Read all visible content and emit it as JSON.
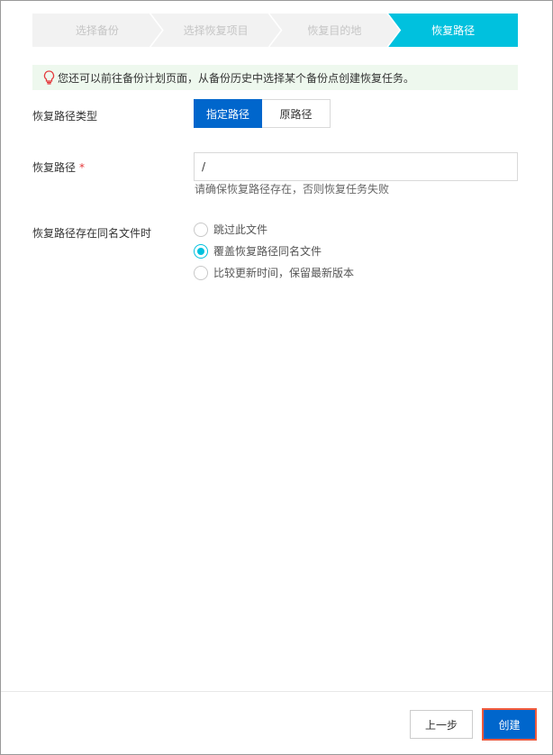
{
  "steps": [
    {
      "label": "选择备份"
    },
    {
      "label": "选择恢复项目"
    },
    {
      "label": "恢复目的地"
    },
    {
      "label": "恢复路径"
    }
  ],
  "tip": {
    "text": "您还可以前往备份计划页面，从备份历史中选择某个备份点创建恢复任务。",
    "icon": "lightbulb-icon"
  },
  "form": {
    "path_type_label": "恢复路径类型",
    "path_type_options": [
      "指定路径",
      "原路径"
    ],
    "path_label": "恢复路径",
    "required_mark": "*",
    "path_value": "/",
    "path_hint": "请确保恢复路径存在，否则恢复任务失败",
    "conflict_label": "恢复路径存在同名文件时",
    "conflict_options": [
      "跳过此文件",
      "覆盖恢复路径同名文件",
      "比较更新时间，保留最新版本"
    ]
  },
  "footer": {
    "prev_label": "上一步",
    "create_label": "创建"
  },
  "colors": {
    "accent": "#00c1de",
    "primary": "#0066cc",
    "highlight": "#f05a3c"
  }
}
